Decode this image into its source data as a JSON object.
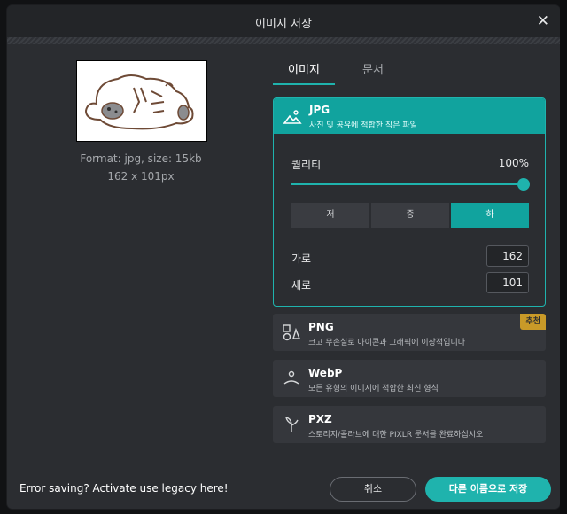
{
  "dialog": {
    "title": "이미지 저장"
  },
  "preview": {
    "format_text": "Format: jpg, size: 15kb",
    "dimensions_text": "162 x 101px"
  },
  "tabs": [
    {
      "label": "이미지",
      "active": true
    },
    {
      "label": "문서",
      "active": false
    }
  ],
  "jpg": {
    "title": "JPG",
    "desc": "사진 및 공유에 적합한 작은 파일",
    "quality_label": "퀄리티",
    "quality_value": "100%",
    "quality_fraction": 1.0,
    "quality_options": [
      {
        "label": "저",
        "active": false
      },
      {
        "label": "중",
        "active": false
      },
      {
        "label": "하",
        "active": true
      }
    ],
    "width_label": "가로",
    "width_value": "162",
    "height_label": "세로",
    "height_value": "101"
  },
  "formats": [
    {
      "title": "PNG",
      "desc": "크고 무손실로 아이콘과 그래픽에 이상적입니다",
      "badge": "추천",
      "icon": "shapes-icon"
    },
    {
      "title": "WebP",
      "desc": "모든 유형의 이미지에 적합한 최신 형식",
      "icon": "webp-icon"
    },
    {
      "title": "PXZ",
      "desc": "스토리지/콜라브에 대한 PIXLR 문서를 완료하십시오",
      "icon": "pxz-icon"
    }
  ],
  "footer": {
    "legacy_text": "Error saving? Activate use legacy here!",
    "cancel_label": "취소",
    "save_label": "다른 이름으로 저장"
  },
  "colors": {
    "accent": "#1fb3ad",
    "badge": "#c99a28",
    "panel": "#2b2d31"
  }
}
